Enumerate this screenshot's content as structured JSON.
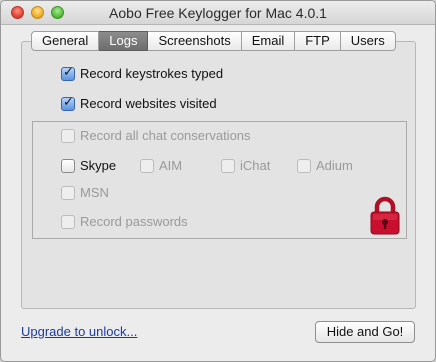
{
  "window": {
    "title": "Aobo Free Keylogger for Mac 4.0.1"
  },
  "tabs": [
    {
      "label": "General",
      "active": false
    },
    {
      "label": "Logs",
      "active": true
    },
    {
      "label": "Screenshots",
      "active": false
    },
    {
      "label": "Email",
      "active": false
    },
    {
      "label": "FTP",
      "active": false
    },
    {
      "label": "Users",
      "active": false
    }
  ],
  "options": {
    "record_keystrokes": {
      "label": "Record keystrokes typed",
      "checked": true
    },
    "record_websites": {
      "label": "Record websites visited",
      "checked": true
    }
  },
  "chat": {
    "record_all": {
      "label": "Record all chat conservations",
      "checked": false,
      "enabled": false
    },
    "skype": {
      "label": "Skype",
      "checked": false,
      "enabled": true
    },
    "aim": {
      "label": "AIM",
      "checked": false,
      "enabled": false
    },
    "ichat": {
      "label": "iChat",
      "checked": false,
      "enabled": false
    },
    "adium": {
      "label": "Adium",
      "checked": false,
      "enabled": false
    },
    "msn": {
      "label": "MSN",
      "checked": false,
      "enabled": false
    },
    "record_passwords": {
      "label": "Record passwords",
      "checked": false,
      "enabled": false
    }
  },
  "icons": {
    "lock": "lock-icon",
    "lock_color": "#c8102e"
  },
  "footer": {
    "upgrade_link": "Upgrade to unlock...",
    "hide_button": "Hide and Go!"
  }
}
